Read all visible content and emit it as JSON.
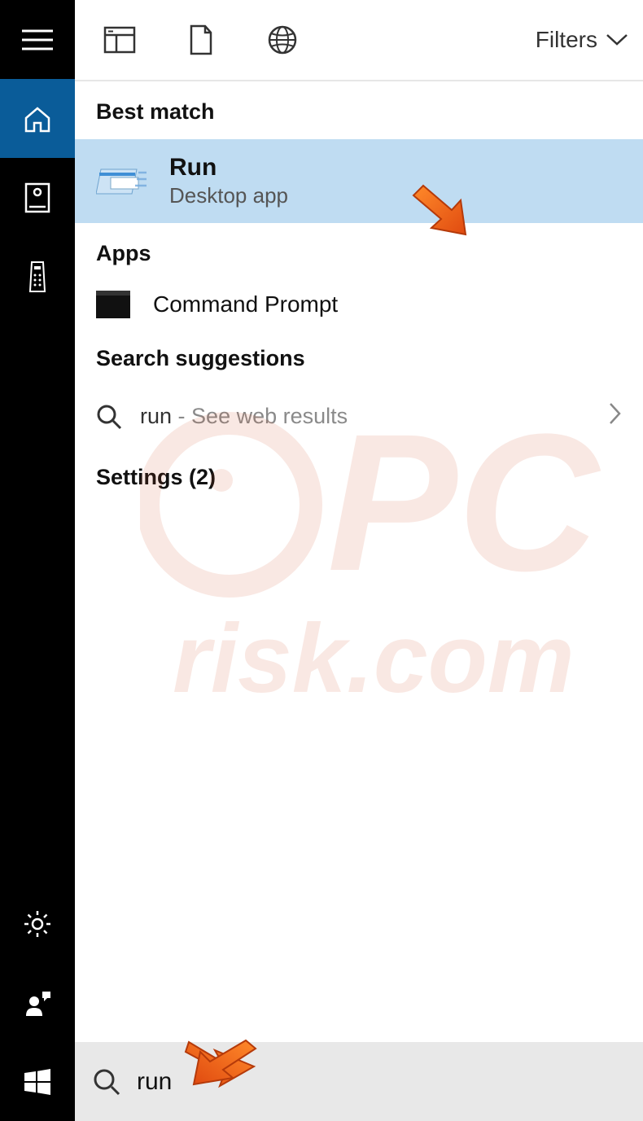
{
  "topbar": {
    "filters_label": "Filters"
  },
  "sections": {
    "best_match": "Best match",
    "apps": "Apps",
    "suggestions": "Search suggestions",
    "settings": "Settings (2)"
  },
  "results": {
    "run": {
      "title": "Run",
      "subtitle": "Desktop app"
    },
    "cmd": {
      "title": "Command Prompt"
    }
  },
  "suggestion": {
    "query": "run",
    "hint": "- See web results"
  },
  "search": {
    "value": "run"
  }
}
